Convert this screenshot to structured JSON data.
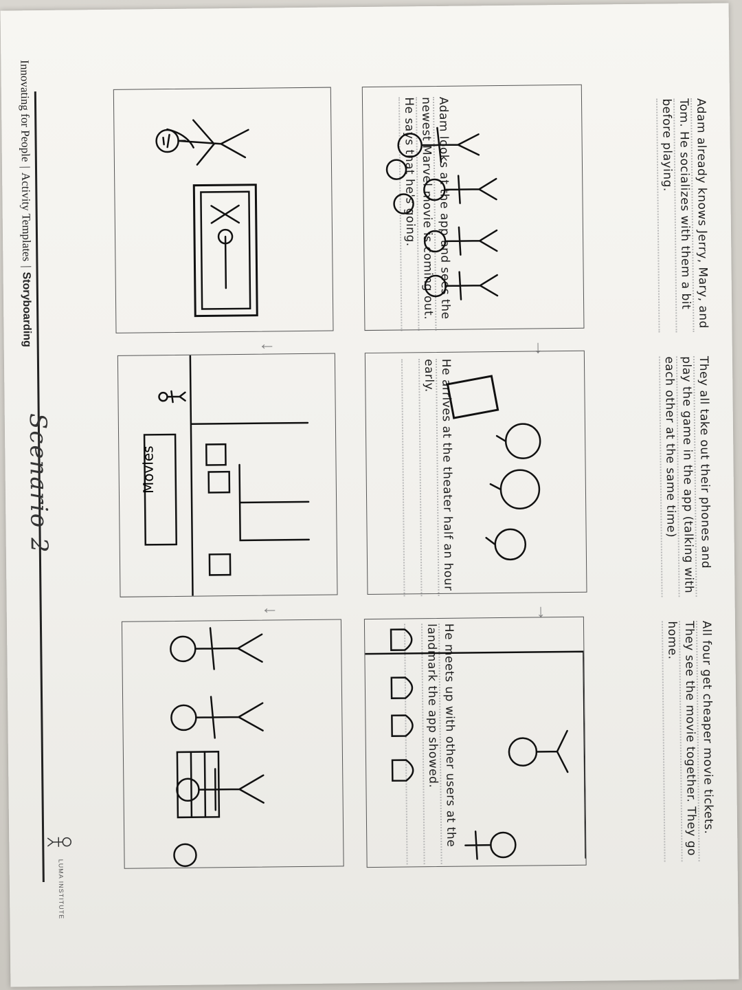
{
  "header": {
    "breadcrumb": [
      "Innovating for People",
      "Activity Templates",
      "Storyboarding"
    ],
    "separator": "|",
    "handwritten_title": "Scenario 2"
  },
  "panels": [
    {
      "caption": "Adam looks at the app and sees the newest Marvel movie is coming out. He says that he's going."
    },
    {
      "caption": "He arrives at the theater half an hour early.",
      "sign_text": "Movies"
    },
    {
      "caption": "He meets up with other users at the landmark the app showed."
    },
    {
      "caption": "Adam already knows Jerry, Mary, and Tom. He socializes with them a bit before playing."
    },
    {
      "caption": "They all take out their phones and play the game in the app (talking with each other at the same time)"
    },
    {
      "caption": "All four get cheaper movie tickets. They see the movie together. They go home."
    }
  ],
  "footer": {
    "logo_text": "LUMA INSTITUTE"
  }
}
